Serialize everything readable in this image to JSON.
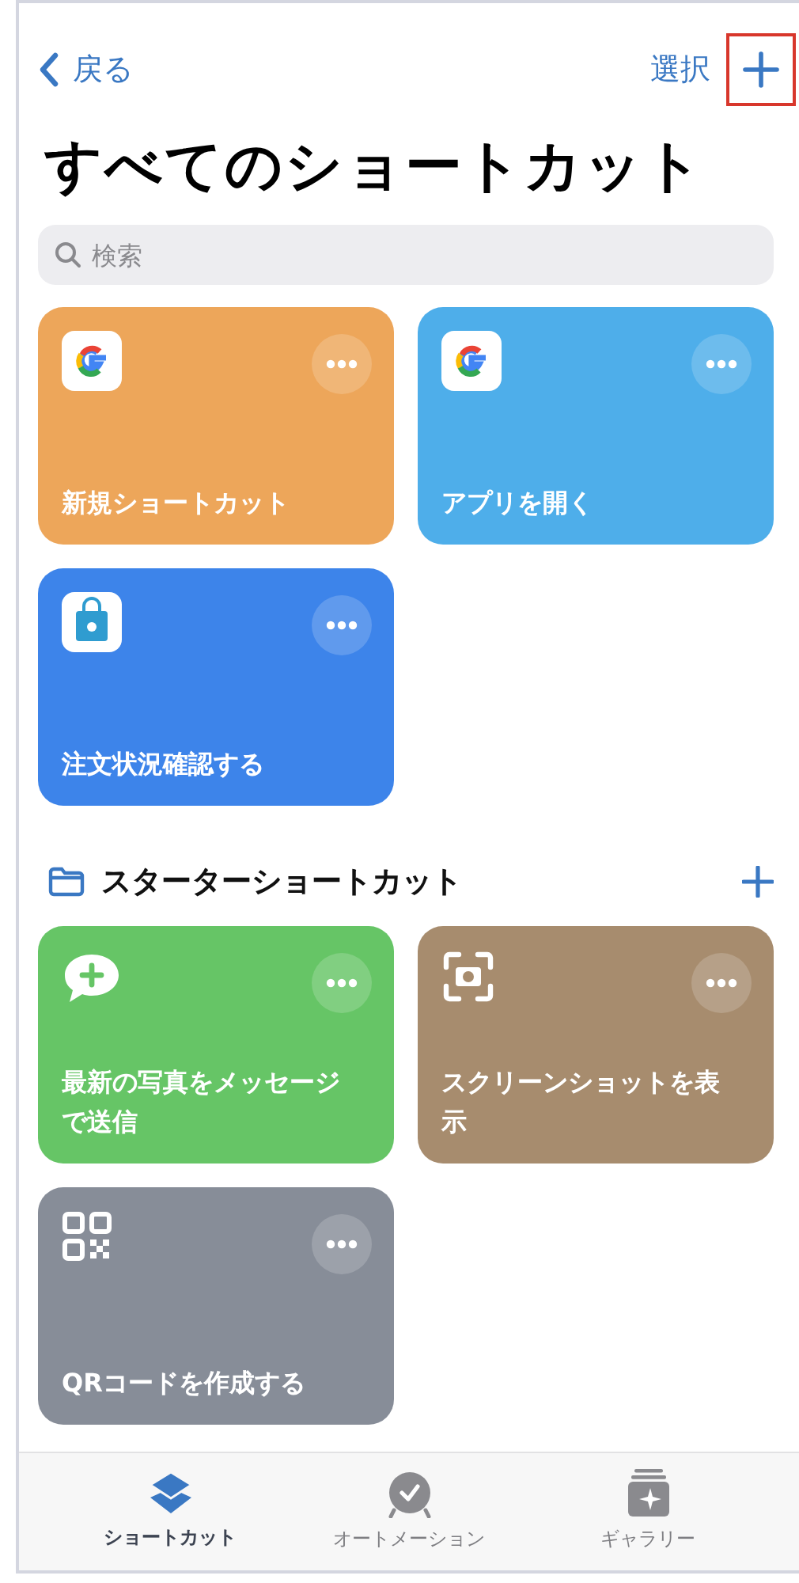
{
  "nav": {
    "back": "戻る",
    "select": "選択",
    "add_highlighted": true
  },
  "title": "すべてのショートカット",
  "search": {
    "placeholder": "検索"
  },
  "shortcuts": [
    {
      "title": "新規ショートカット",
      "kind": "google",
      "color": "#eda65a"
    },
    {
      "title": "アプリを開く",
      "kind": "google",
      "color": "#4eaeea"
    },
    {
      "title": "注文状況確認する",
      "kind": "bag",
      "color": "#3d84ea"
    }
  ],
  "section": {
    "title": "スターターショートカット"
  },
  "starter_shortcuts": [
    {
      "title": "最新の写真をメッセージで送信",
      "kind": "message",
      "color": "#66c566"
    },
    {
      "title": "スクリーンショットを表示",
      "kind": "screenshot",
      "color": "#a78c6e"
    },
    {
      "title": "QRコードを作成する",
      "kind": "qr",
      "color": "#878d98"
    }
  ],
  "tabs": [
    {
      "label": "ショートカット",
      "kind": "layers",
      "selected": true
    },
    {
      "label": "オートメーション",
      "kind": "clock",
      "selected": false
    },
    {
      "label": "ギャラリー",
      "kind": "gallery",
      "selected": false
    }
  ]
}
